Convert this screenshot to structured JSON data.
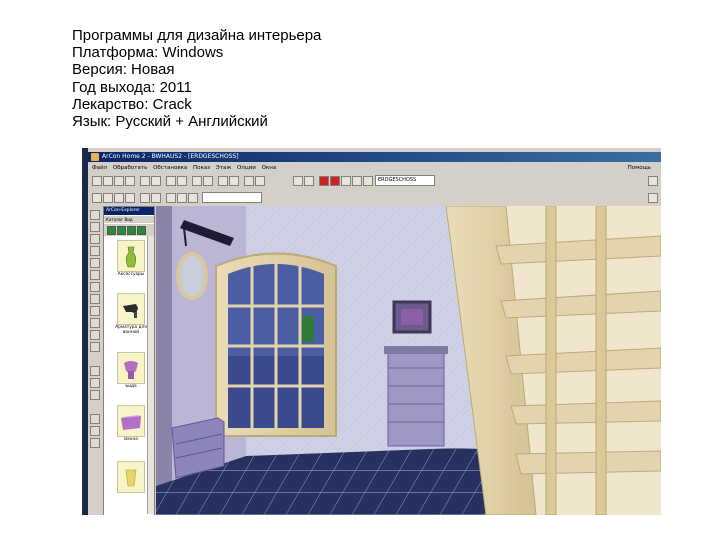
{
  "info_lines": {
    "l1": "Программы для дизайна интерьера",
    "l2": "Платформа: Windows",
    "l3": "Версия: Новая",
    "l4": "Год выхода: 2011",
    "l5": "Лекарство: Crack",
    "l6": "Язык: Русский + Английский"
  },
  "app": {
    "title": "ArCon Home 2 - BWHAUS2 - [ERDGESCHOSS]",
    "menu": [
      "Файл",
      "Обработать",
      "Обстановка",
      "Показ",
      "Этаж",
      "Опции",
      "Окна"
    ],
    "help": "Помощь",
    "floor_combo": "ERDGESCHOSS"
  },
  "catalog": {
    "title": "ArCon-Explorer",
    "menu": "Каталог  Вид",
    "items": [
      "Аксессуары",
      "Арматура для ванной",
      "Биде",
      "Ванна"
    ]
  },
  "colors": {
    "titlebar": "#0a246a",
    "floor": "#26315f",
    "wood": "#e3d3ae"
  }
}
